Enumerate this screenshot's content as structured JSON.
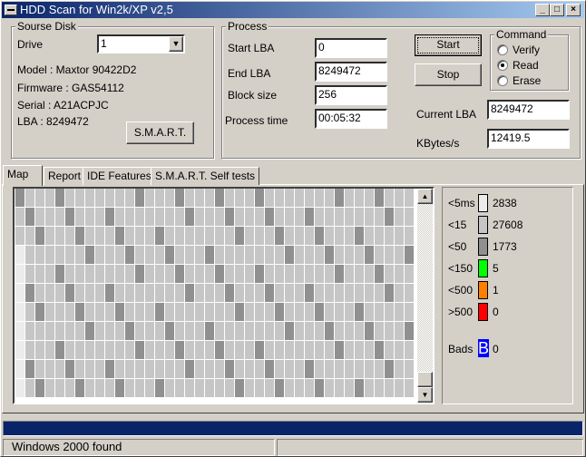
{
  "window": {
    "title": "HDD Scan for Win2k/XP  v2,5",
    "minimize": "_",
    "maximize": "□",
    "close": "×"
  },
  "source_disk": {
    "label": "Sourse Disk",
    "drive_label": "Drive",
    "drive_value": "1",
    "model": "Model : Maxtor 90422D2",
    "firmware": "Firmware : GAS54112",
    "serial": "Serial : A21ACPJC",
    "lba": "LBA :  8249472",
    "smart_button": "S.M.A.R.T."
  },
  "process": {
    "label": "Process",
    "start_lba_label": "Start LBA",
    "start_lba": "0",
    "end_lba_label": "End LBA",
    "end_lba": "8249472",
    "block_size_label": "Block size",
    "block_size": "256",
    "process_time_label": "Process time",
    "process_time": "00:05:32",
    "start_button": "Start",
    "stop_button": "Stop",
    "current_lba_label": "Current LBA",
    "current_lba": "8249472",
    "kbytes_label": "KBytes/s",
    "kbytes": "12419.5"
  },
  "command": {
    "label": "Command",
    "options": [
      {
        "label": "Verify",
        "selected": false
      },
      {
        "label": "Read",
        "selected": true
      },
      {
        "label": "Erase",
        "selected": false
      }
    ]
  },
  "tabs": [
    {
      "label": "Map",
      "active": true
    },
    {
      "label": "Report"
    },
    {
      "label": "IDE Features"
    },
    {
      "label": "S.M.A.R.T. Self tests"
    }
  ],
  "legend": [
    {
      "label": "<5ms",
      "count": "2838",
      "color": "#ececec"
    },
    {
      "label": "<15",
      "count": "27608",
      "color": "#c6c6c6"
    },
    {
      "label": "<50",
      "count": "1773",
      "color": "#909090"
    },
    {
      "label": "<150",
      "count": "5",
      "color": "#00ff00"
    },
    {
      "label": "<500",
      "count": "1",
      "color": "#ff8000"
    },
    {
      "label": ">500",
      "count": "0",
      "color": "#ff0000"
    }
  ],
  "bads": {
    "label": "Bads",
    "glyph": "B",
    "count": "0",
    "color": "#0000ff"
  },
  "progress": {
    "percent": 100,
    "color": "#0a246a"
  },
  "status": {
    "text": "Windows 2000 found",
    "right": ""
  }
}
